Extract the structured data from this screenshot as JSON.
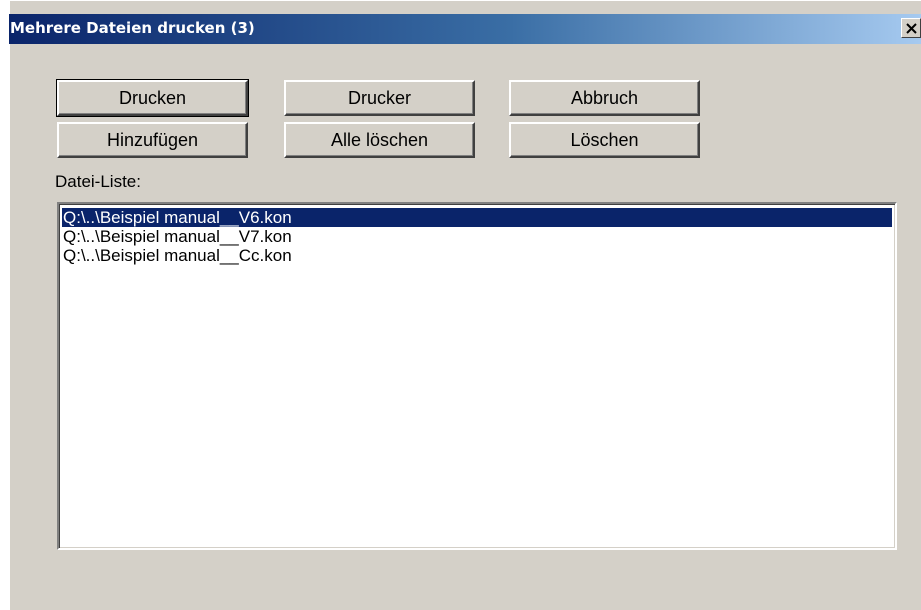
{
  "window": {
    "title": "Mehrere Dateien drucken (3)",
    "close_label": "X"
  },
  "buttons": {
    "print": "Drucken",
    "printer": "Drucker",
    "cancel": "Abbruch",
    "add": "Hinzufügen",
    "delete_all": "Alle löschen",
    "delete": "Löschen"
  },
  "file_list": {
    "label": "Datei-Liste:",
    "selected_index": 0,
    "items": [
      "Q:\\..\\Beispiel manual__V6.kon",
      "Q:\\..\\Beispiel manual__V7.kon",
      "Q:\\..\\Beispiel manual__Cc.kon"
    ]
  },
  "colors": {
    "titlebar_start": "#0a246a",
    "titlebar_end": "#a6caf0",
    "dialog_background": "#d4d0c8",
    "selection_background": "#0a246a"
  }
}
